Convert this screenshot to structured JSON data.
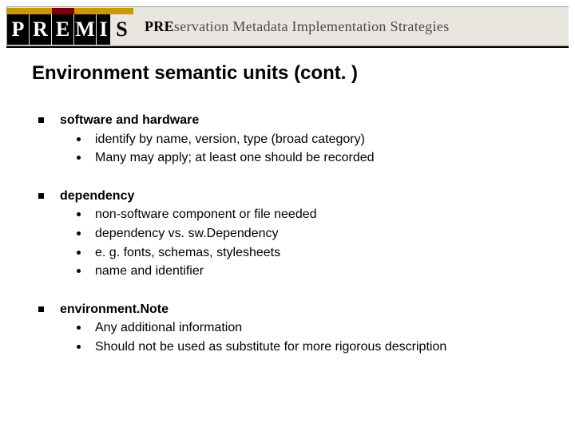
{
  "logo": {
    "letters": [
      "P",
      "R",
      "E",
      "M",
      "I",
      "S"
    ],
    "accent_colors": [
      "#c79a00",
      "#c79a00",
      "#7a0000",
      "#c79a00",
      "#c79a00",
      "#c79a00"
    ],
    "tagline_html": "PREservation Metadata Implementation Strategies",
    "tag_bold_prefix": "PRE",
    "tag_rest": "servation Metadata Implementation Strategies"
  },
  "title": "Environment semantic units (cont. )",
  "items": [
    {
      "title": "software and hardware",
      "subs": [
        "identify by name, version, type (broad category)",
        "Many may apply; at least one should be recorded"
      ]
    },
    {
      "title": "dependency",
      "subs": [
        "non-software component or file needed",
        "dependency vs. sw.Dependency",
        "e. g. fonts, schemas, stylesheets",
        "name and identifier"
      ]
    },
    {
      "title": "environment.Note",
      "subs": [
        "Any additional information",
        "Should not be used as substitute for more rigorous description"
      ]
    }
  ]
}
